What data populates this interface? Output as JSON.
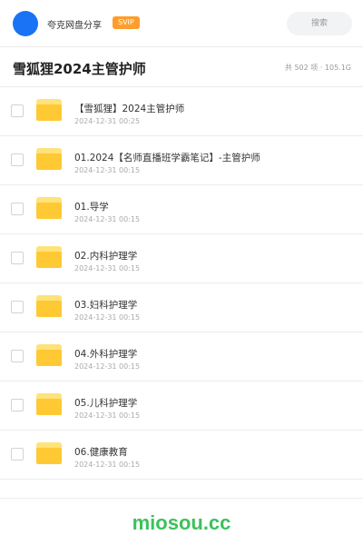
{
  "header": {
    "share_name": "夸克网盘分享",
    "badge": "SVIP",
    "search_placeholder": "搜索"
  },
  "title_bar": {
    "title": "雪狐狸2024主管护师",
    "summary": "共 502 项 · 105.1G"
  },
  "files": [
    {
      "name": "【雪狐狸】2024主管护师",
      "date": "2024-12-31 00:25",
      "icon": "folder-icon"
    },
    {
      "name": "01.2024【名师直播班学霸笔记】-主管护师",
      "date": "2024-12-31 00:15",
      "icon": "folder-icon"
    },
    {
      "name": "01.导学",
      "date": "2024-12-31 00:15",
      "icon": "folder-icon"
    },
    {
      "name": "02.内科护理学",
      "date": "2024-12-31 00:15",
      "icon": "folder-icon"
    },
    {
      "name": "03.妇科护理学",
      "date": "2024-12-31 00:15",
      "icon": "folder-icon"
    },
    {
      "name": "04.外科护理学",
      "date": "2024-12-31 00:15",
      "icon": "folder-icon"
    },
    {
      "name": "05.儿科护理学",
      "date": "2024-12-31 00:15",
      "icon": "folder-icon"
    },
    {
      "name": "06.健康教育",
      "date": "2024-12-31 00:15",
      "icon": "folder-icon"
    }
  ],
  "watermark": "miosou.cc",
  "colors": {
    "avatar": "#1a73f5",
    "badge": "#ff9d2b",
    "folder": "#ffc933",
    "watermark": "#3cc25a"
  }
}
